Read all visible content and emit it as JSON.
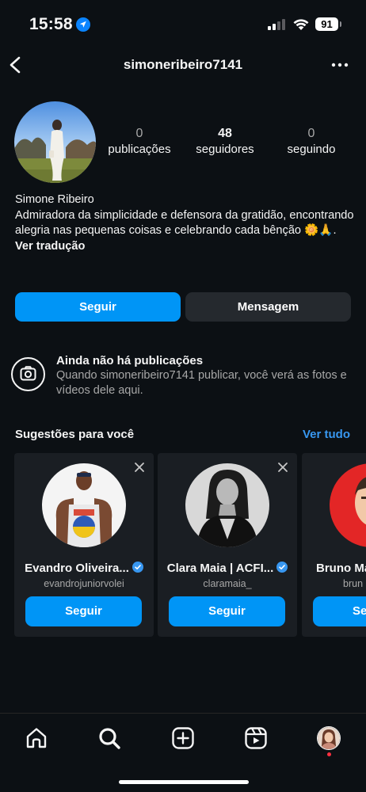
{
  "status_bar": {
    "time": "15:58",
    "battery": "91"
  },
  "header": {
    "username": "simoneribeiro7141"
  },
  "profile": {
    "stats": {
      "posts_count": "0",
      "posts_label": "publicações",
      "followers_count": "48",
      "followers_label": "seguidores",
      "following_count": "0",
      "following_label": "seguindo"
    },
    "name": "Simone Ribeiro",
    "bio": "Admiradora da simplicidade e defensora da gratidão, encontrando alegria nas pequenas coisas e celebrando cada bênção 🌼🙏.",
    "translate_link": "Ver tradução"
  },
  "actions": {
    "follow_label": "Seguir",
    "message_label": "Mensagem"
  },
  "empty_state": {
    "title": "Ainda não há publicações",
    "description": "Quando simoneribeiro7141 publicar, você verá as fotos e vídeos dele aqui."
  },
  "suggestions": {
    "title": "Sugestões para você",
    "see_all": "Ver tudo",
    "cards": [
      {
        "name": "Evandro Oliveira...",
        "handle": "evandrojuniorvolei",
        "button": "Seguir",
        "verified": true
      },
      {
        "name": "Clara Maia | ACFI...",
        "handle": "claramaia_",
        "button": "Seguir",
        "verified": true
      },
      {
        "name": "Bruno Ma",
        "handle": "brun",
        "button": "Se",
        "verified": false
      }
    ]
  },
  "colors": {
    "background": "#0c1014",
    "primary_button": "#0095f6",
    "secondary_button": "#25292e",
    "link": "#3897f0",
    "card": "#1a1e23",
    "notification_dot": "#ff3040"
  },
  "tab_icons": [
    "home-icon",
    "search-icon",
    "create-icon",
    "reels-icon",
    "profile-avatar"
  ]
}
